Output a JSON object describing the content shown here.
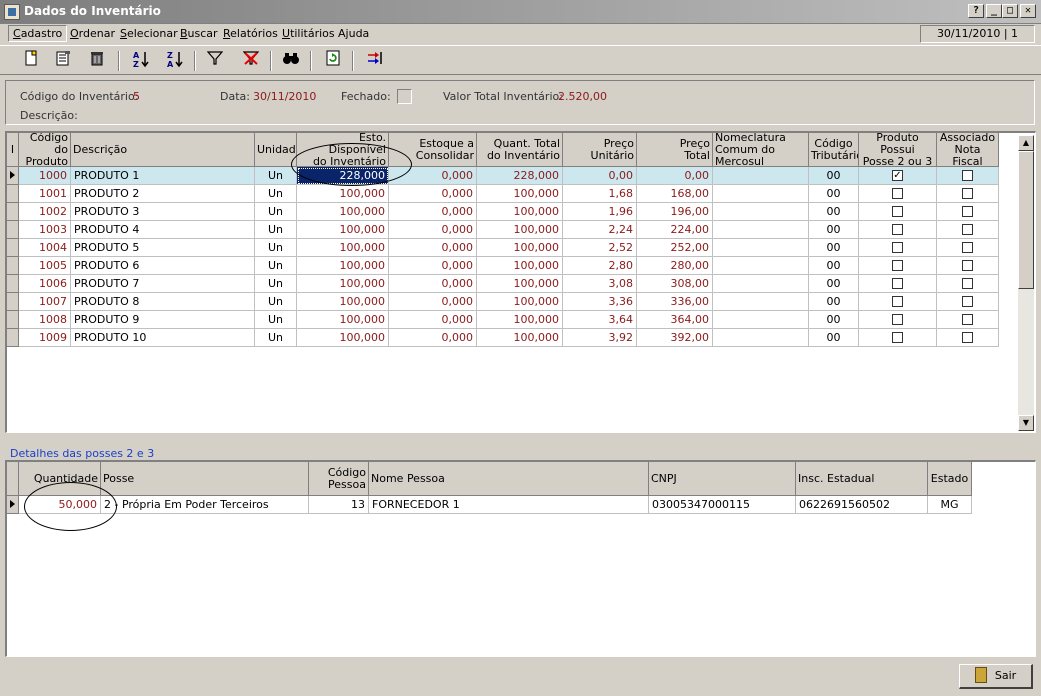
{
  "window": {
    "title": "Dados do Inventário",
    "help": "?",
    "min": "_",
    "max": "□",
    "close": "✕"
  },
  "menu": {
    "items": [
      {
        "pre": "",
        "ul": "C",
        "post": "adastro"
      },
      {
        "pre": "",
        "ul": "O",
        "post": "rdenar"
      },
      {
        "pre": "",
        "ul": "S",
        "post": "elecionar"
      },
      {
        "pre": "",
        "ul": "B",
        "post": "uscar"
      },
      {
        "pre": "",
        "ul": "R",
        "post": "elatórios"
      },
      {
        "pre": "",
        "ul": "U",
        "post": "tilitários"
      },
      {
        "pre": "A",
        "ul": "j",
        "post": "uda"
      }
    ],
    "date_panel": "30/11/2010 | 1"
  },
  "toolbar": {
    "icons": [
      "new-icon",
      "edit-icon",
      "delete-icon",
      "sort-az-icon",
      "sort-za-icon",
      "filter-icon",
      "clear-filter-icon",
      "binoculars-icon",
      "refresh-icon",
      "import-icon"
    ]
  },
  "info": {
    "codigo_label": "Código do Inventário:",
    "codigo_value": "5",
    "data_label": "Data:",
    "data_value": "30/11/2010",
    "fechado_label": "Fechado:",
    "valor_label": "Valor Total Inventário:",
    "valor_value": "2.520,00",
    "descricao_label": "Descrição:"
  },
  "grid1": {
    "indicator_header": "I",
    "headers": [
      "Código do\nProduto",
      "Descrição",
      "Unidade",
      "Esto. Disponível\ndo Inventário",
      "Estoque a\nConsolidar",
      "Quant. Total\ndo Inventário",
      "Preço\nUnitário",
      "Preço\nTotal",
      "Nomeclatura\nComum do Mercosul",
      "Código\nTributário",
      "Produto Possui\nPosse 2 ou 3",
      "Associado\nNota Fiscal"
    ],
    "rows": [
      [
        "1000",
        "PRODUTO 1",
        "Un",
        "228,000",
        "0,000",
        "228,000",
        "0,00",
        "0,00",
        "",
        "00",
        true,
        false
      ],
      [
        "1001",
        "PRODUTO 2",
        "Un",
        "100,000",
        "0,000",
        "100,000",
        "1,68",
        "168,00",
        "",
        "00",
        false,
        false
      ],
      [
        "1002",
        "PRODUTO 3",
        "Un",
        "100,000",
        "0,000",
        "100,000",
        "1,96",
        "196,00",
        "",
        "00",
        false,
        false
      ],
      [
        "1003",
        "PRODUTO 4",
        "Un",
        "100,000",
        "0,000",
        "100,000",
        "2,24",
        "224,00",
        "",
        "00",
        false,
        false
      ],
      [
        "1004",
        "PRODUTO 5",
        "Un",
        "100,000",
        "0,000",
        "100,000",
        "2,52",
        "252,00",
        "",
        "00",
        false,
        false
      ],
      [
        "1005",
        "PRODUTO 6",
        "Un",
        "100,000",
        "0,000",
        "100,000",
        "2,80",
        "280,00",
        "",
        "00",
        false,
        false
      ],
      [
        "1006",
        "PRODUTO 7",
        "Un",
        "100,000",
        "0,000",
        "100,000",
        "3,08",
        "308,00",
        "",
        "00",
        false,
        false
      ],
      [
        "1007",
        "PRODUTO 8",
        "Un",
        "100,000",
        "0,000",
        "100,000",
        "3,36",
        "336,00",
        "",
        "00",
        false,
        false
      ],
      [
        "1008",
        "PRODUTO 9",
        "Un",
        "100,000",
        "0,000",
        "100,000",
        "3,64",
        "364,00",
        "",
        "00",
        false,
        false
      ],
      [
        "1009",
        "PRODUTO 10",
        "Un",
        "100,000",
        "0,000",
        "100,000",
        "3,92",
        "392,00",
        "",
        "00",
        false,
        false
      ]
    ]
  },
  "detalhes": {
    "label": "Detalhes das posses 2 e 3",
    "headers": [
      "Quantidade",
      "Posse",
      "Código\nPessoa",
      "Nome Pessoa",
      "CNPJ",
      "Insc. Estadual",
      "Estado"
    ],
    "rows": [
      [
        "50,000",
        "2 - Própria Em Poder Terceiros",
        "13",
        "FORNECEDOR 1",
        "03005347000115",
        "0622691560502",
        "MG"
      ]
    ]
  },
  "footer": {
    "sair_label": "Sair"
  }
}
